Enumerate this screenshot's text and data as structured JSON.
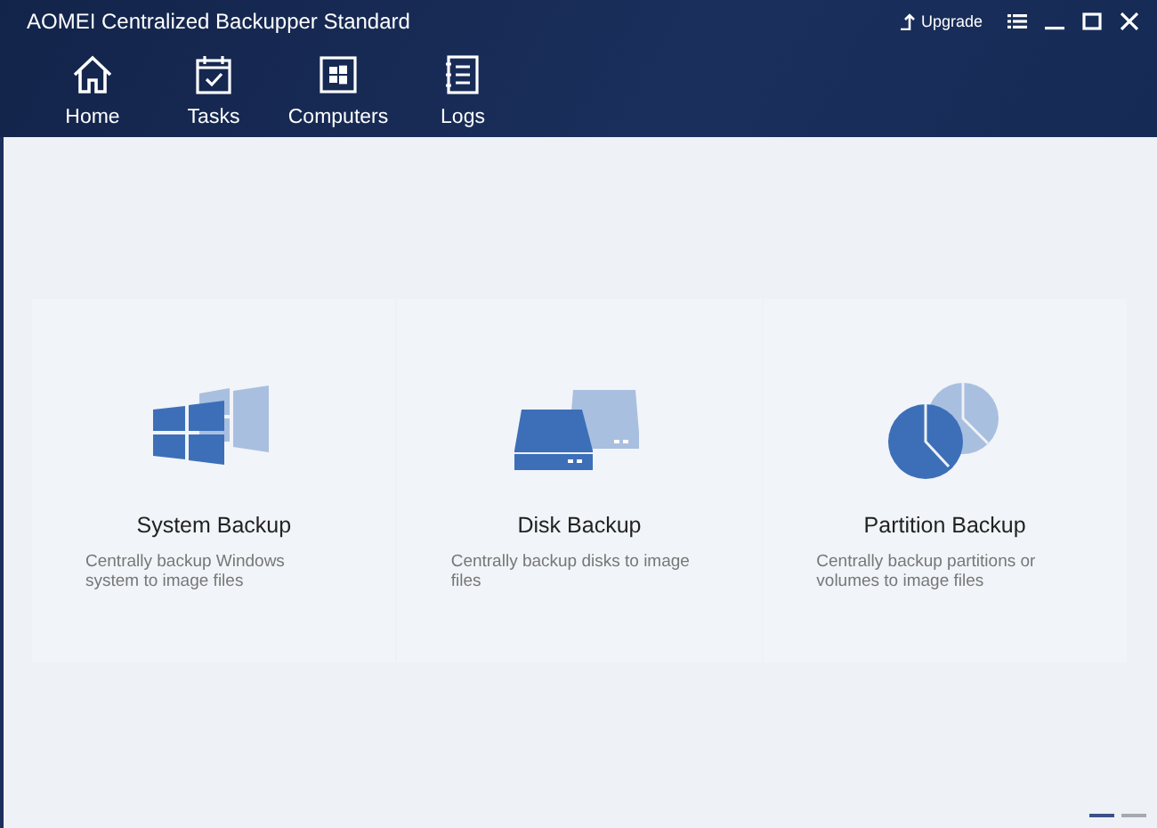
{
  "window": {
    "title": "AOMEI Centralized Backupper Standard",
    "upgrade": "Upgrade"
  },
  "nav": [
    {
      "kind": "home",
      "label": "Home"
    },
    {
      "kind": "tasks",
      "label": "Tasks"
    },
    {
      "kind": "computers",
      "label": "Computers"
    },
    {
      "kind": "logs",
      "label": "Logs"
    }
  ],
  "cards": [
    {
      "kind": "system",
      "title": "System Backup",
      "description": "Centrally backup Windows system to image files"
    },
    {
      "kind": "disk",
      "title": "Disk Backup",
      "description": "Centrally backup disks to image files"
    },
    {
      "kind": "partition",
      "title": "Partition Backup",
      "description": "Centrally backup partitions or volumes to image files"
    }
  ],
  "pager": [
    {
      "selected": true
    },
    {
      "selected": false
    }
  ]
}
